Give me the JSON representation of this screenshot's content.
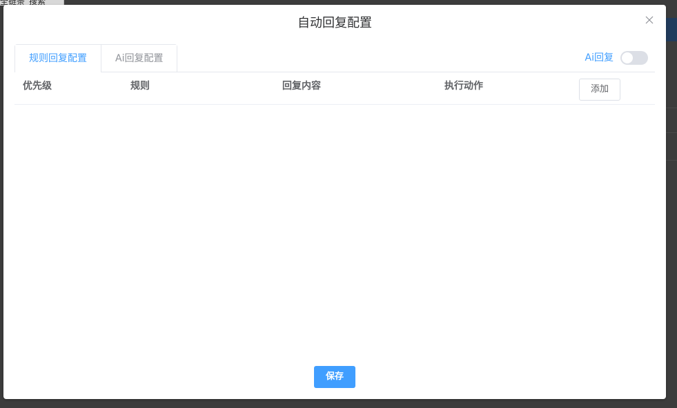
{
  "background": {
    "tab_label": "全链条_搜索"
  },
  "dialog": {
    "title": "自动回复配置"
  },
  "tabs": [
    {
      "label": "规则回复配置",
      "active": true
    },
    {
      "label": "Ai回复配置",
      "active": false
    }
  ],
  "ai_switch": {
    "label": "Ai回复",
    "on": false
  },
  "table": {
    "columns": [
      "优先级",
      "规则",
      "回复内容",
      "执行动作"
    ],
    "add_label": "添加",
    "rows": []
  },
  "footer": {
    "save_label": "保存"
  },
  "colors": {
    "accent": "#409eff",
    "overlay": "#3c3c3c",
    "border": "#e4e7ed"
  },
  "icons": {
    "close": "close-icon"
  }
}
